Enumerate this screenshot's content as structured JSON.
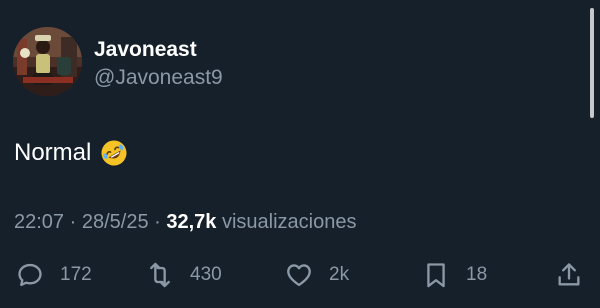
{
  "author": {
    "display_name": "Javoneast",
    "handle": "@Javoneast9",
    "avatar_icon": "profile-photo"
  },
  "tweet": {
    "text": "Normal",
    "emoji": "rolling-on-the-floor-laughing"
  },
  "meta": {
    "time": "22:07",
    "separator1": " · ",
    "date": "28/5/25",
    "separator2": " · ",
    "views_count": "32,7k",
    "views_label": " visualizaciones"
  },
  "actions": {
    "replies": "172",
    "reposts": "430",
    "likes": "2k",
    "bookmarks": "18"
  },
  "colors": {
    "background": "#15202b",
    "primary_text": "#ffffff",
    "secondary_text": "#8b98a5"
  }
}
